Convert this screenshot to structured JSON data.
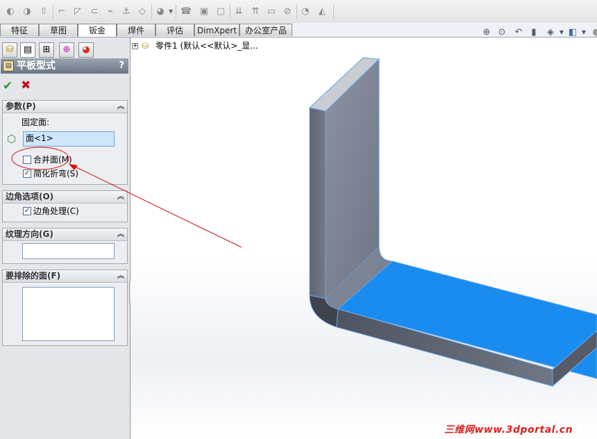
{
  "toolbar": {
    "icons": [
      "sweep-icon",
      "loft-icon",
      "extrude-icon",
      "edge-flange-icon",
      "miter-flange-icon",
      "hem-icon",
      "jog-icon",
      "sketched-bend-icon",
      "cross-break-icon",
      "closed-corner-icon",
      "corner-relief-icon",
      "rip-icon",
      "insert-bends-icon",
      "no-bends-icon",
      "flatten-icon",
      "unfold-icon",
      "fold-icon",
      "forming-tool-icon",
      "vent-icon",
      "convert-icon"
    ]
  },
  "command_tabs": [
    {
      "label": "特征"
    },
    {
      "label": "草图"
    },
    {
      "label": "钣金"
    },
    {
      "label": "焊件"
    },
    {
      "label": "评估"
    },
    {
      "label": "DimXpert"
    },
    {
      "label": "办公室产品"
    }
  ],
  "active_tab": "钣金",
  "property_manager": {
    "title": "平板型式",
    "help": "?",
    "ok_symbol": "✔",
    "cancel_symbol": "✖",
    "groups": {
      "parameters": {
        "header": "参数(P)",
        "fixed_face_label": "固定面:",
        "fixed_face_value": "面<1>",
        "merge_faces_label": "合并面(M)",
        "merge_faces_checked": false,
        "simplify_bends_label": "简化折弯(S)",
        "simplify_bends_checked": true
      },
      "corner_options": {
        "header": "边角选项(O)",
        "corner_treatment_label": "边角处理(C)",
        "corner_treatment_checked": true
      },
      "grain_direction": {
        "header": "纹理方向(G)",
        "value": ""
      },
      "faces_to_exclude": {
        "header": "要排除的面(F)",
        "value": ""
      }
    }
  },
  "tree": {
    "part_label": "零件1  (默认<<默认>_显..."
  },
  "view_toolbar": {
    "icons": [
      "zoom-to-fit-icon",
      "zoom-to-area-icon",
      "previous-view-icon",
      "section-view-icon",
      "view-orientation-icon",
      "display-style-icon"
    ]
  },
  "watermark": "三维网www.3dportal.cn",
  "colors": {
    "selected_face": "#1a8cf0",
    "annotation_red": "#d01010",
    "part_gray": "#6b7280"
  }
}
